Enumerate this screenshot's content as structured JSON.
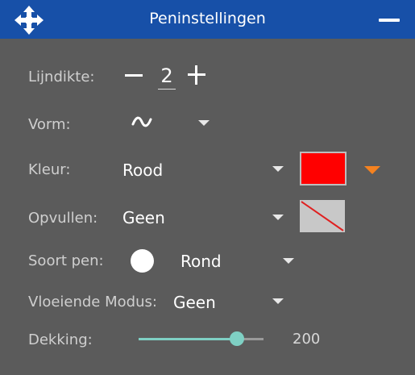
{
  "window": {
    "title": "Peninstellingen"
  },
  "thickness": {
    "label": "Lijndikte:",
    "value": "2"
  },
  "shape": {
    "label": "Vorm:"
  },
  "color": {
    "label": "Kleur:",
    "value": "Rood",
    "swatch": "#ff0000",
    "accent": "#f58220"
  },
  "fill": {
    "label": "Opvullen:",
    "value": "Geen"
  },
  "pen": {
    "label": "Soort pen:",
    "value": "Rond"
  },
  "blend": {
    "label": "Vloeiende Modus:",
    "value": "Geen"
  },
  "opacity": {
    "label": "Dekking:",
    "value": "200",
    "max": 255
  },
  "colors": {
    "titlebar": "#1750a8",
    "panel": "#5b5b5b",
    "slider": "#7fd0c4"
  },
  "icons": [
    "move-icon",
    "minimize-icon",
    "minus-icon",
    "plus-icon",
    "wave-icon",
    "chevron-down-icon",
    "round-pen-icon"
  ]
}
